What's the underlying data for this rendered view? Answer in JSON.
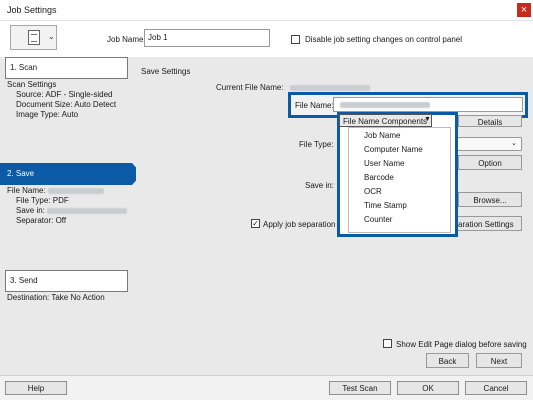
{
  "window": {
    "title": "Job Settings",
    "close_glyph": "×"
  },
  "toolbar": {
    "job_name_label": "Job Name",
    "job_name_value": "Job 1",
    "disable_label": "Disable job setting changes on control panel"
  },
  "steps": {
    "scan": {
      "label": "1. Scan",
      "heading": "Scan Settings",
      "source": "Source: ADF - Single-sided",
      "doc_size": "Document Size: Auto Detect",
      "image_type": "Image Type: Auto"
    },
    "save": {
      "label": "2. Save",
      "file_name": "File Name:",
      "file_type": "File Type: PDF",
      "save_in": "Save in:",
      "separator": "Separator: Off"
    },
    "send": {
      "label": "3. Send",
      "destination": "Destination: Take No Action"
    }
  },
  "save_settings": {
    "heading": "Save Settings",
    "current_file_label": "Current File Name:",
    "file_name_label": "File Name:",
    "details_label": "Details",
    "file_type_label": "File Type:",
    "option_label": "Option",
    "save_in_label": "Save in:",
    "browse_label": "Browse...",
    "apply_label": "Apply job separation",
    "apply_checked": true,
    "apply_check_glyph": "✓",
    "separation_settings_label": "aration Settings",
    "components_label": "File Name Components",
    "components": [
      "Job Name",
      "Computer Name",
      "User Name",
      "Barcode",
      "OCR",
      "Time Stamp",
      "Counter"
    ]
  },
  "footer_main": {
    "show_edit_label": "Show Edit Page dialog before saving",
    "back_label": "Back",
    "next_label": "Next"
  },
  "bottom": {
    "help_label": "Help",
    "test_scan_label": "Test Scan",
    "ok_label": "OK",
    "cancel_label": "Cancel"
  },
  "colors": {
    "accent": "#0b5aa6",
    "close": "#c42b1c"
  }
}
